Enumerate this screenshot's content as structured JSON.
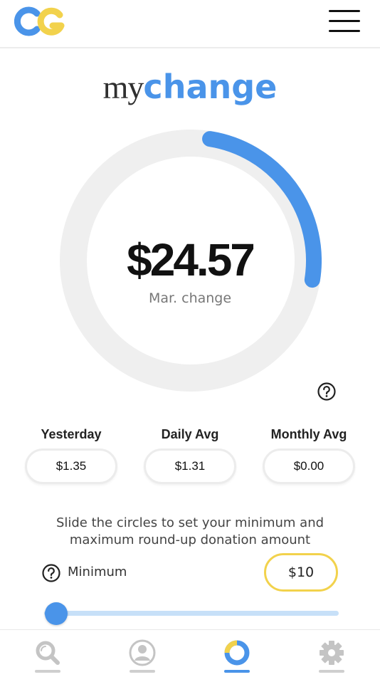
{
  "header": {
    "logo_icon": "cg-logo",
    "menu_icon": "hamburger-menu-icon"
  },
  "brand": {
    "part1": "my",
    "part2": "change"
  },
  "summary": {
    "amount": "$24.57",
    "label": "Mar. change",
    "progress_fraction": 0.25,
    "help_icon": "question-circle-icon"
  },
  "stats": [
    {
      "label": "Yesterday",
      "value": "$1.35"
    },
    {
      "label": "Daily Avg",
      "value": "$1.31"
    },
    {
      "label": "Monthly Avg",
      "value": "$0.00"
    }
  ],
  "roundup": {
    "instruction": "Slide the circles to set your minimum and maximum round-up donation amount",
    "minimum_label": "Minimum",
    "minimum_value": "$10",
    "help_icon": "question-circle-icon",
    "slider_fraction": 0.0
  },
  "tabs": [
    {
      "name": "search",
      "icon": "search-icon",
      "active": false
    },
    {
      "name": "profile",
      "icon": "user-icon",
      "active": false
    },
    {
      "name": "mychange",
      "icon": "donut-chart-icon",
      "active": true
    },
    {
      "name": "settings",
      "icon": "gear-icon",
      "active": false
    }
  ],
  "colors": {
    "accent_blue": "#4a94e9",
    "accent_yellow": "#f2d24c",
    "ring_track": "#efefef",
    "slider_track": "#c7e0f8"
  }
}
